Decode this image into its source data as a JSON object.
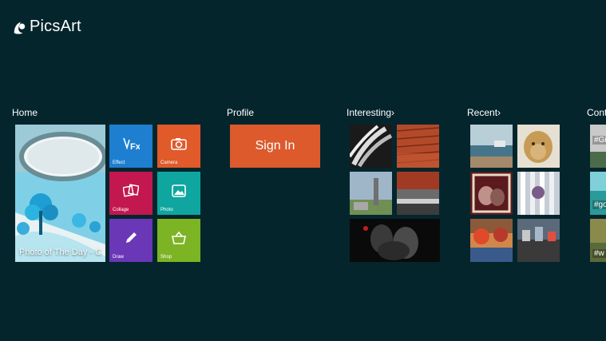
{
  "app": {
    "name": "PicsArt"
  },
  "sections": {
    "home": {
      "title": "Home"
    },
    "profile": {
      "title": "Profile"
    },
    "interesting": {
      "title": "Interesting"
    },
    "recent": {
      "title": "Recent"
    },
    "contests": {
      "title": "Conte"
    }
  },
  "home": {
    "photo_of_the_day": {
      "label": "Photo of The Day - C"
    },
    "tiles": [
      {
        "label": "Effect",
        "color": "#1e7fd0",
        "icon": "effect-fx-icon"
      },
      {
        "label": "Camera",
        "color": "#e05a2a",
        "icon": "camera-icon"
      },
      {
        "label": "Collage",
        "color": "#c3174f",
        "icon": "collage-icon"
      },
      {
        "label": "Photo",
        "color": "#0ea69f",
        "icon": "photo-icon"
      },
      {
        "label": "Draw",
        "color": "#6a37b6",
        "icon": "pencil-icon"
      },
      {
        "label": "Shop",
        "color": "#7cb424",
        "icon": "shopping-basket-icon"
      }
    ]
  },
  "profile": {
    "signin_label": "Sign In",
    "signin_color": "#dc5a2c"
  },
  "contests": {
    "tags": [
      "#Gi",
      "#go",
      "#w"
    ]
  }
}
